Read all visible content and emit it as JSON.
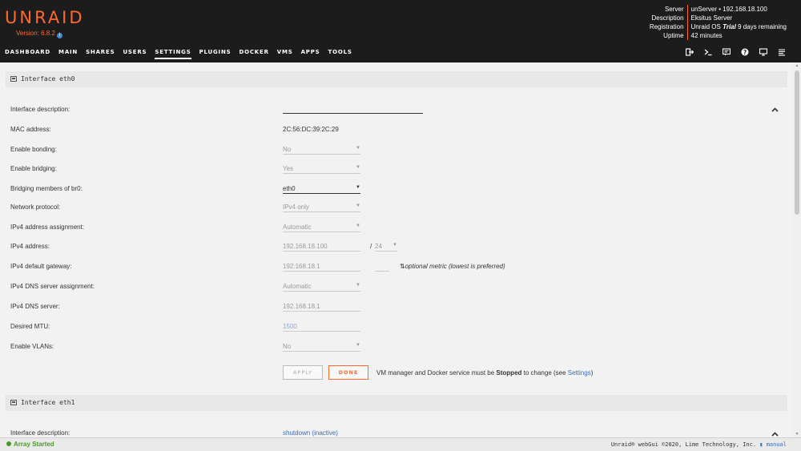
{
  "header": {
    "logo": "UNRAID",
    "version": "Version: 6.8.2",
    "server_info": [
      {
        "key": "Server",
        "value": "unServer • 192.168.18.100"
      },
      {
        "key": "Description",
        "value": "Eksitus Server"
      },
      {
        "key": "Registration",
        "value_pre": "Unraid OS ",
        "value_em": "Trial",
        "value_post": " 9 days remaining"
      },
      {
        "key": "Uptime",
        "value": "42 minutes"
      }
    ]
  },
  "nav": {
    "items": [
      "DASHBOARD",
      "MAIN",
      "SHARES",
      "USERS",
      "SETTINGS",
      "PLUGINS",
      "DOCKER",
      "VMS",
      "APPS",
      "TOOLS"
    ],
    "active": "SETTINGS",
    "icons": [
      "logout-icon",
      "terminal-icon",
      "feedback-icon",
      "help-icon",
      "log-icon",
      "menu-icon"
    ]
  },
  "eth0": {
    "title": "Interface eth0",
    "fields": {
      "description_label": "Interface description:",
      "description_value": "",
      "mac_label": "MAC address:",
      "mac_value": "2C:56:DC:39:2C:29",
      "bonding_label": "Enable bonding:",
      "bonding_value": "No",
      "bridging_label": "Enable bridging:",
      "bridging_value": "Yes",
      "bridge_members_label": "Bridging members of br0:",
      "bridge_members_value": "eth0",
      "protocol_label": "Network protocol:",
      "protocol_value": "IPv4 only",
      "ipv4_assign_label": "IPv4 address assignment:",
      "ipv4_assign_value": "Automatic",
      "ipv4_addr_label": "IPv4 address:",
      "ipv4_addr_value": "192.168.18.100",
      "ipv4_mask_value": "24",
      "gateway_label": "IPv4 default gateway:",
      "gateway_value": "192.168.18.1",
      "metric_note": "optional metric (lowest is preferred)",
      "dns_assign_label": "IPv4 DNS server assignment:",
      "dns_assign_value": "Automatic",
      "dns_label": "IPv4 DNS server:",
      "dns_value": "192.168.18.1",
      "mtu_label": "Desired MTU:",
      "mtu_placeholder": "1500",
      "vlans_label": "Enable VLANs:",
      "vlans_value": "No"
    },
    "apply_label": "APPLY",
    "done_label": "DONE",
    "note_pre": "VM manager and Docker service must be ",
    "note_bold": "Stopped",
    "note_mid": " to change (see ",
    "note_link": "Settings",
    "note_post": ")"
  },
  "eth1": {
    "title": "Interface eth1",
    "description_label": "Interface description:",
    "description_value": "shutdown (inactive)"
  },
  "footer": {
    "array_status": "Array Started",
    "copyright": "Unraid® webGui ©2020, Lime Technology, Inc.",
    "manual": "manual"
  },
  "colors": {
    "accent": "#ff6a2b",
    "header_bg": "#1c1c1c",
    "link": "#3b6cb7",
    "status_green": "#4a9a2a"
  }
}
